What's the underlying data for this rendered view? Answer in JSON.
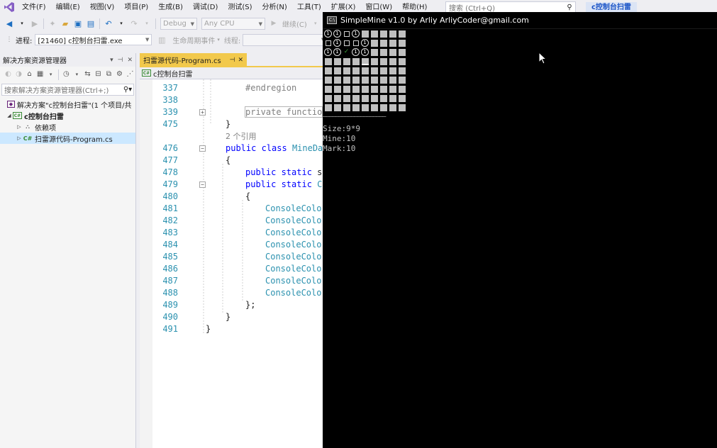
{
  "menubar": {
    "items": [
      "文件(F)",
      "编辑(E)",
      "视图(V)",
      "项目(P)",
      "生成(B)",
      "调试(D)",
      "测试(S)",
      "分析(N)",
      "工具(T)",
      "扩展(X)",
      "窗口(W)",
      "帮助(H)"
    ],
    "search_placeholder": "搜索 (Ctrl+Q)",
    "solution_badge": "c控制台扫雷"
  },
  "toolbar": {
    "config": "Debug",
    "platform": "Any CPU",
    "continue_label": "继续(C)"
  },
  "debugbar": {
    "process_label": "进程:",
    "process_value": "[21460] c控制台扫雷.exe",
    "lifecycle_label": "生命周期事件",
    "thread_label": "线程:"
  },
  "solution_explorer": {
    "title": "解决方案资源管理器",
    "search_placeholder": "搜索解决方案资源管理器(Ctrl+;)",
    "tree": {
      "solution": "解决方案\"c控制台扫雷\"(1 个项目/共",
      "project": "c控制台扫雷",
      "dependencies": "依赖项",
      "file": "扫雷源代码-Program.cs",
      "cs_icon_text": "C#"
    }
  },
  "document": {
    "tab_title": "扫雷源代码-Program.cs",
    "nav_project": "c控制台扫雷"
  },
  "code_lines": [
    {
      "ln": "337",
      "text": "#endregion"
    },
    {
      "ln": "338",
      "text": ""
    },
    {
      "ln": "339",
      "text": "private functio"
    },
    {
      "ln": "475",
      "text": "}"
    },
    {
      "ln": "",
      "text": "2 个引用"
    },
    {
      "ln": "476",
      "kw": "public class",
      "ty": "MineDa"
    },
    {
      "ln": "477",
      "text": "{"
    },
    {
      "ln": "478",
      "kw": "public static",
      "tail": "s"
    },
    {
      "ln": "479",
      "kw": "public static",
      "ty": "C"
    },
    {
      "ln": "480",
      "text": "{"
    },
    {
      "ln": "481",
      "ty": "ConsoleColo"
    },
    {
      "ln": "482",
      "ty": "ConsoleColo"
    },
    {
      "ln": "483",
      "ty": "ConsoleColo"
    },
    {
      "ln": "484",
      "ty": "ConsoleColo"
    },
    {
      "ln": "485",
      "ty": "ConsoleColo"
    },
    {
      "ln": "486",
      "ty": "ConsoleColo"
    },
    {
      "ln": "487",
      "ty": "ConsoleColo"
    },
    {
      "ln": "488",
      "ty": "ConsoleColo"
    },
    {
      "ln": "489",
      "text": "};"
    },
    {
      "ln": "490",
      "text": "}"
    },
    {
      "ln": "491",
      "text": "}"
    }
  ],
  "console": {
    "title": "SimpleMine v1.0 by Arliy ArliyCoder@gmail.com",
    "icon_text": "C:\\",
    "info": [
      "Size:9*9",
      "Mine:10",
      "Mark:10"
    ],
    "grid": [
      [
        "1",
        "1",
        "o",
        "1",
        "c",
        "c",
        "c",
        "c",
        "c"
      ],
      [
        "o",
        "1",
        "o",
        "o",
        "1",
        "c",
        "c",
        "c",
        "c"
      ],
      [
        "1",
        "1",
        "g",
        "1",
        "1",
        "c",
        "c",
        "c",
        "c"
      ],
      [
        "c",
        "c",
        "c",
        "c",
        "k",
        "c",
        "c",
        "c",
        "c"
      ],
      [
        "c",
        "c",
        "c",
        "c",
        "c",
        "c",
        "c",
        "c",
        "c"
      ],
      [
        "c",
        "c",
        "c",
        "c",
        "c",
        "c",
        "c",
        "c",
        "c"
      ],
      [
        "c",
        "c",
        "c",
        "c",
        "c",
        "c",
        "c",
        "c",
        "c"
      ],
      [
        "c",
        "c",
        "c",
        "c",
        "c",
        "c",
        "c",
        "c",
        "c"
      ],
      [
        "c",
        "c",
        "c",
        "c",
        "c",
        "c",
        "c",
        "c",
        "c"
      ]
    ],
    "grid_underline": "————————————————————"
  }
}
